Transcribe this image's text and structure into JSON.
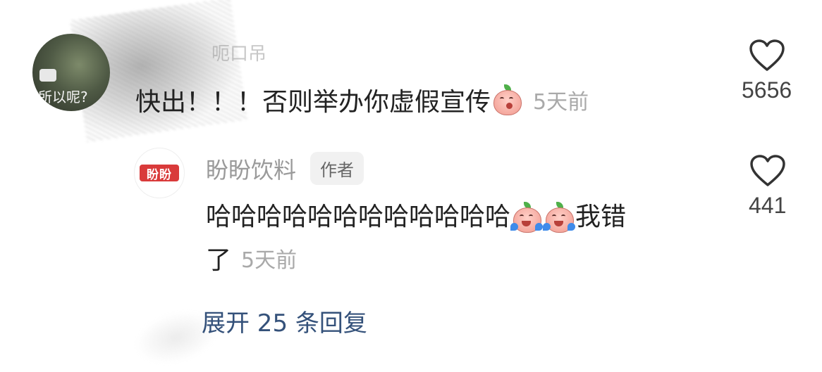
{
  "comment": {
    "username": "呃口吊",
    "avatar_caption": "所以呢?",
    "text": "快出！！！否则举办你虚假宣传",
    "time": "5天前",
    "likes": "5656"
  },
  "reply": {
    "author": "盼盼饮料",
    "badge": "作者",
    "avatar_logo": "盼盼",
    "text_line1": "哈哈哈哈哈哈哈哈哈哈哈哈",
    "text_after_emoji": "我错",
    "text_line2": "了",
    "time": "5天前",
    "likes": "441"
  },
  "expand_replies": "展开 25 条回复",
  "icons": {
    "like": "heart-outline-icon",
    "emoji_shy": "peach-shy-emoji-icon",
    "emoji_cry": "peach-cry-emoji-icon"
  },
  "colors": {
    "link": "#34517a",
    "muted": "#a9a9a9",
    "brand_red": "#d93a3a"
  }
}
